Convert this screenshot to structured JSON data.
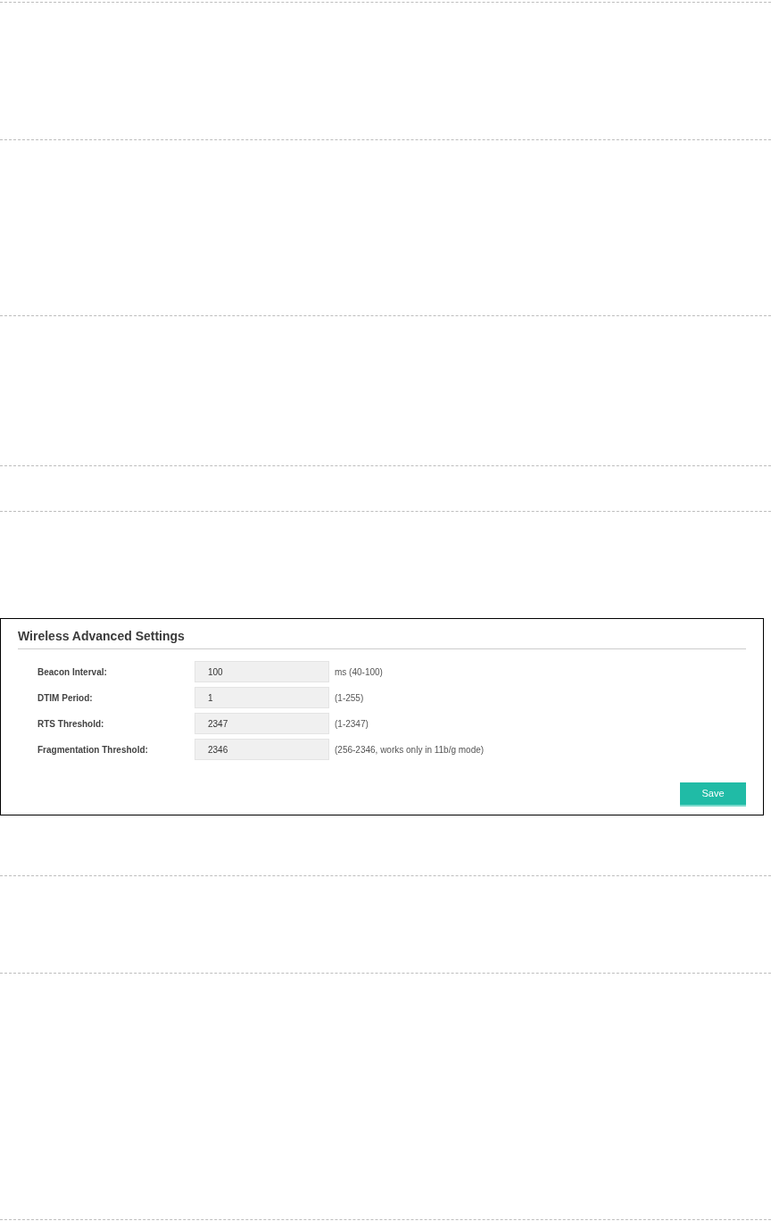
{
  "panel": {
    "title": "Wireless Advanced Settings",
    "fields": [
      {
        "label": "Beacon Interval:",
        "value": "100",
        "hint": "ms (40-100)"
      },
      {
        "label": "DTIM Period:",
        "value": "1",
        "hint": "(1-255)"
      },
      {
        "label": "RTS Threshold:",
        "value": "2347",
        "hint": "(1-2347)"
      },
      {
        "label": "Fragmentation Threshold:",
        "value": "2346",
        "hint": "(256-2346, works only in 11b/g mode)"
      }
    ],
    "save_button": "Save"
  }
}
